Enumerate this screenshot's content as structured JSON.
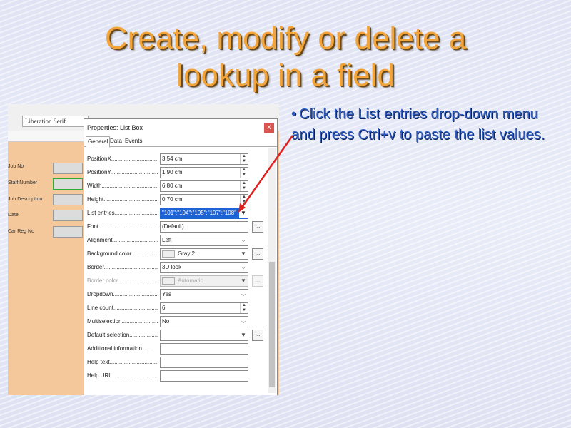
{
  "slide": {
    "title_line1": "Create, modify or delete a",
    "title_line2": "lookup in a field",
    "bullet": "Click the List entries drop-down menu and press Ctrl+v to paste the list values."
  },
  "toolbar": {
    "font": "Liberation Serif"
  },
  "form": {
    "labels": [
      "Job No",
      "Staff Number",
      "Job Description",
      "Date",
      "Car Reg No"
    ]
  },
  "dialog": {
    "title": "Properties: List Box",
    "tabs": [
      "General",
      "Data",
      "Events"
    ],
    "properties": [
      {
        "label": "PositionX.................................",
        "value": "3.54 cm"
      },
      {
        "label": "PositionY.................................",
        "value": "1.90 cm"
      },
      {
        "label": "Width.......................................",
        "value": "6.80 cm"
      },
      {
        "label": "Height.......................................",
        "value": "0.70 cm"
      },
      {
        "label": "List entries................................",
        "value": "\"101\";\"104\";\"105\";\"107\";\"108\""
      },
      {
        "label": "Font..........................................",
        "value": "(Default)"
      },
      {
        "label": "Alignment..................................",
        "value": "Left"
      },
      {
        "label": "Background color.....................",
        "value": "Gray 2"
      },
      {
        "label": "Border........................................",
        "value": "3D look"
      },
      {
        "label": "Border color...............................",
        "value": "Automatic"
      },
      {
        "label": "Dropdown..................................",
        "value": "Yes"
      },
      {
        "label": "Line count.................................",
        "value": "6"
      },
      {
        "label": "Multiselection...........................",
        "value": "No"
      },
      {
        "label": "Default selection......................",
        "value": ""
      },
      {
        "label": "Additional information.....",
        "value": ""
      },
      {
        "label": "Help text...................................",
        "value": ""
      },
      {
        "label": "Help URL...................................",
        "value": ""
      }
    ],
    "close": "x",
    "more": "..."
  },
  "colors": {
    "title": "#f2a43a",
    "bullet": "#2d5bbf",
    "arrow": "#e02020",
    "selection": "#1e63d6"
  }
}
